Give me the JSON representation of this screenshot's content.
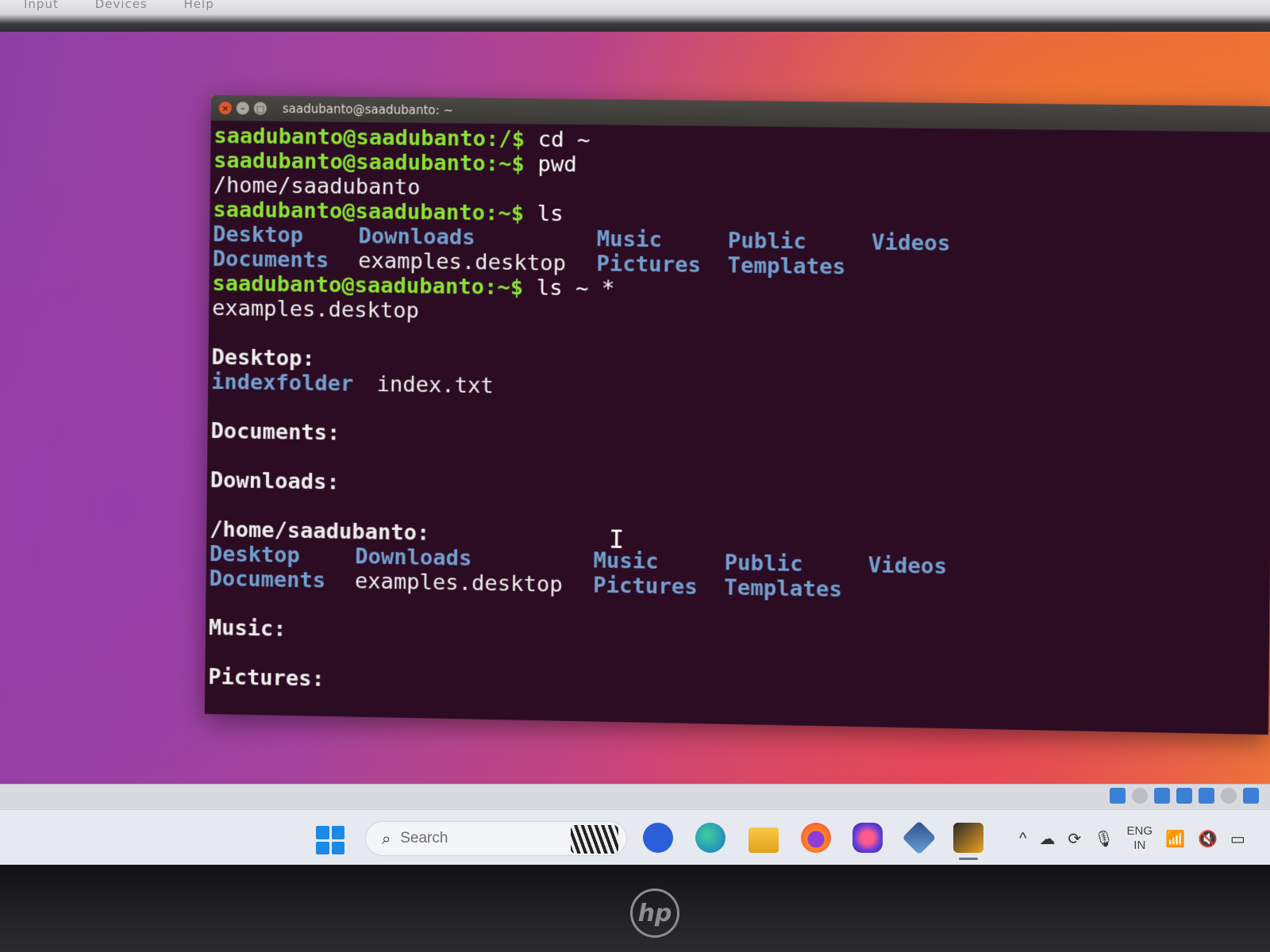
{
  "vm_menu": [
    "Input",
    "Devices",
    "Help"
  ],
  "terminal": {
    "title": "saadubanto@saadubanto: ~",
    "cursor_glyph": "I",
    "lines": [
      {
        "type": "cmd",
        "prompt": "saadubanto@saadubanto:/$",
        "command": " cd ~"
      },
      {
        "type": "cmd",
        "prompt": "saadubanto@saadubanto:~$",
        "command": " pwd"
      },
      {
        "type": "out",
        "text": "/home/saadubanto"
      },
      {
        "type": "cmd",
        "prompt": "saadubanto@saadubanto:~$",
        "command": " ls"
      },
      {
        "type": "cols",
        "items": [
          {
            "t": "Desktop",
            "k": "dir"
          },
          {
            "t": "Downloads",
            "k": "dir"
          },
          {
            "t": "Music",
            "k": "dir"
          },
          {
            "t": "Public",
            "k": "dir"
          },
          {
            "t": "Videos",
            "k": "dir"
          }
        ]
      },
      {
        "type": "cols",
        "items": [
          {
            "t": "Documents",
            "k": "dir"
          },
          {
            "t": "examples.desktop",
            "k": "file"
          },
          {
            "t": "Pictures",
            "k": "dir"
          },
          {
            "t": "Templates",
            "k": "dir"
          }
        ]
      },
      {
        "type": "cmd",
        "prompt": "saadubanto@saadubanto:~$",
        "command": " ls ~ *"
      },
      {
        "type": "out",
        "text": "examples.desktop"
      },
      {
        "type": "blank"
      },
      {
        "type": "heading",
        "text": "Desktop:"
      },
      {
        "type": "pair",
        "items": [
          {
            "t": "indexfolder",
            "k": "dir"
          },
          {
            "t": "index.txt",
            "k": "file"
          }
        ]
      },
      {
        "type": "blank"
      },
      {
        "type": "heading",
        "text": "Documents:"
      },
      {
        "type": "blank"
      },
      {
        "type": "heading",
        "text": "Downloads:"
      },
      {
        "type": "blank"
      },
      {
        "type": "heading",
        "text": "/home/saadubanto:"
      },
      {
        "type": "cols",
        "items": [
          {
            "t": "Desktop",
            "k": "dir"
          },
          {
            "t": "Downloads",
            "k": "dir"
          },
          {
            "t": "Music",
            "k": "dir"
          },
          {
            "t": "Public",
            "k": "dir"
          },
          {
            "t": "Videos",
            "k": "dir"
          }
        ]
      },
      {
        "type": "cols",
        "items": [
          {
            "t": "Documents",
            "k": "dir"
          },
          {
            "t": "examples.desktop",
            "k": "file"
          },
          {
            "t": "Pictures",
            "k": "dir"
          },
          {
            "t": "Templates",
            "k": "dir"
          }
        ]
      },
      {
        "type": "blank"
      },
      {
        "type": "heading",
        "text": "Music:"
      },
      {
        "type": "blank"
      },
      {
        "type": "heading",
        "text": "Pictures:"
      }
    ]
  },
  "taskbar": {
    "search_placeholder": "Search",
    "apps": [
      "meet-icon",
      "edge-icon",
      "file-explorer-icon",
      "firefox-icon",
      "copilot-icon",
      "virtualbox-icon",
      "vm-window-icon"
    ],
    "tray": {
      "language": "ENG",
      "region": "IN"
    }
  },
  "colors": {
    "prompt": "#8ae234",
    "directory": "#729fcf",
    "terminal_bg": "#2c0c23",
    "taskbar_bg": "#e6e9f0"
  },
  "brand": "hp"
}
